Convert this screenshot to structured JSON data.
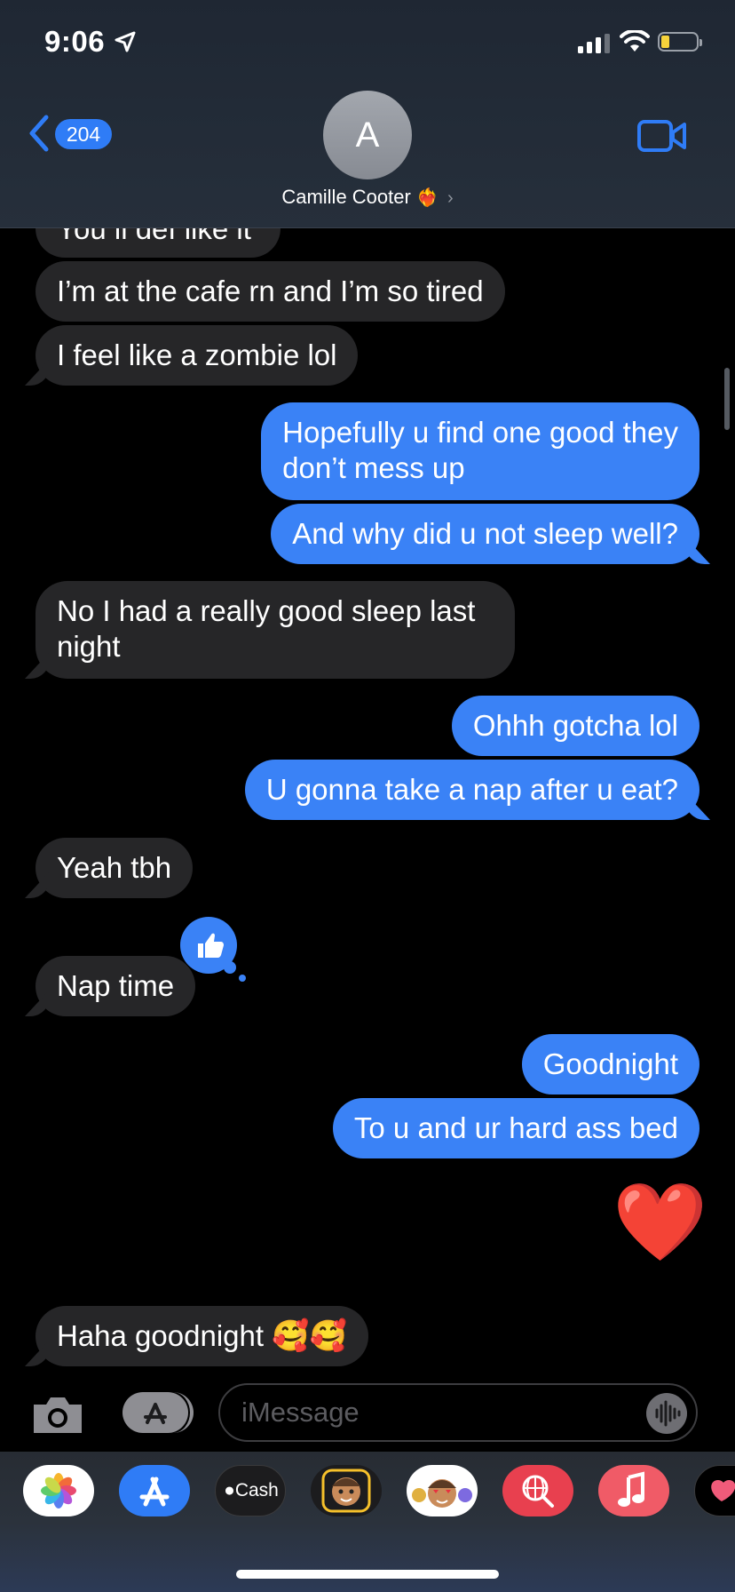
{
  "status_bar": {
    "time": "9:06"
  },
  "header": {
    "back_count": "204",
    "avatar_initial": "A",
    "contact_name": "Camille Cooter",
    "heart_glyph": "❤️‍🔥",
    "chevron": "›"
  },
  "messages": [
    {
      "from": "them",
      "text": "You ll def like it"
    },
    {
      "from": "them",
      "text": "I’m at the cafe rn and I’m so tired"
    },
    {
      "from": "them",
      "text": "I feel like a zombie lol"
    },
    {
      "from": "me",
      "line1": "Hopefully u find one good they",
      "line2": "don’t mess up"
    },
    {
      "from": "me",
      "text": "And why did u not sleep well?"
    },
    {
      "from": "them",
      "line1": "No I had a really good sleep last",
      "line2": "night"
    },
    {
      "from": "me",
      "text": "Ohhh gotcha lol"
    },
    {
      "from": "me",
      "text": "U gonna take a nap after u eat?"
    },
    {
      "from": "them",
      "text": "Yeah tbh"
    },
    {
      "from": "them",
      "text": "Nap time",
      "tapback": "thumbs-up-icon"
    },
    {
      "from": "me",
      "text": "Goodnight"
    },
    {
      "from": "me",
      "text": "To u and ur hard ass bed"
    },
    {
      "from": "me",
      "text": "❤️"
    },
    {
      "from": "them",
      "text": "Haha goodnight",
      "emoji": "🥰🥰"
    }
  ],
  "compose": {
    "placeholder": "iMessage"
  },
  "drawer": {
    "apps": [
      {
        "name": "photos",
        "color": "#ffffff"
      },
      {
        "name": "app-store",
        "color": "#2f7cf6"
      },
      {
        "name": "apple-cash",
        "color": "#1c1c1e",
        "label": "Cash"
      },
      {
        "name": "memoji",
        "color": "#1c1c1e"
      },
      {
        "name": "memoji-stickers",
        "color": "#ffffff"
      },
      {
        "name": "images-search",
        "color": "#e8404f"
      },
      {
        "name": "music",
        "color": "#f05b67"
      },
      {
        "name": "digital-touch",
        "color": "#000000"
      }
    ]
  },
  "colors": {
    "sent_bubble": "#3a82f6",
    "received_bubble": "#262628",
    "accent": "#2f7cf6"
  }
}
